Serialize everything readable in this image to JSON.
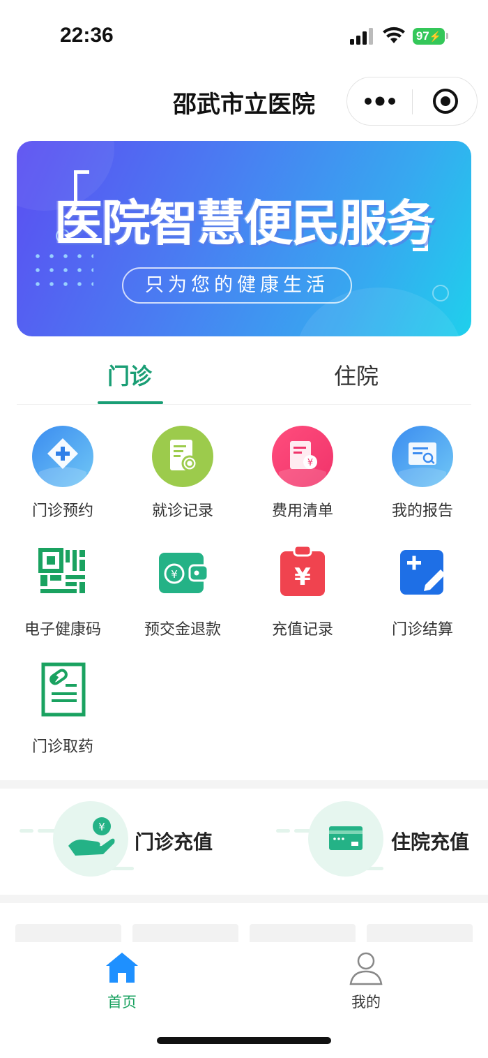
{
  "status_bar": {
    "time": "22:36",
    "battery": "97"
  },
  "nav": {
    "title": "邵武市立医院"
  },
  "banner": {
    "title": "医院智慧便民服务",
    "subtitle": "只为您的健康生活"
  },
  "tabs": [
    {
      "label": "门诊",
      "active": true
    },
    {
      "label": "住院",
      "active": false
    }
  ],
  "services": [
    {
      "label": "门诊预约",
      "icon": "appointment-icon"
    },
    {
      "label": "就诊记录",
      "icon": "visit-record-icon"
    },
    {
      "label": "费用清单",
      "icon": "bill-icon"
    },
    {
      "label": "我的报告",
      "icon": "report-icon"
    },
    {
      "label": "电子健康码",
      "icon": "qr-code-icon"
    },
    {
      "label": "预交金退款",
      "icon": "wallet-icon"
    },
    {
      "label": "充值记录",
      "icon": "recharge-record-icon"
    },
    {
      "label": "门诊结算",
      "icon": "settlement-icon"
    },
    {
      "label": "门诊取药",
      "icon": "medicine-icon"
    }
  ],
  "recharge": [
    {
      "label": "门诊充值",
      "icon": "hand-coin-icon"
    },
    {
      "label": "住院充值",
      "icon": "card-icon"
    }
  ],
  "tabbar": [
    {
      "label": "首页",
      "icon": "home-icon",
      "active": true
    },
    {
      "label": "我的",
      "icon": "user-icon",
      "active": false
    }
  ],
  "colors": {
    "accent": "#1a9e75",
    "tabbar_active": "#1aa260",
    "tabbar_home_icon": "#1e90ff"
  }
}
